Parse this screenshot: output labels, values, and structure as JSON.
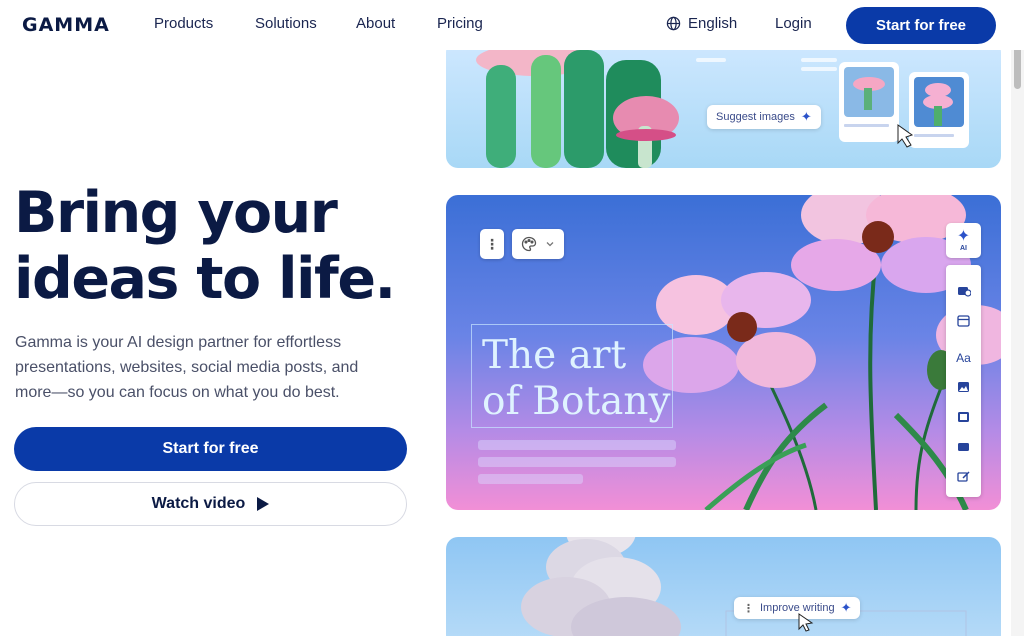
{
  "brand": {
    "logo_text": "GAMMA",
    "accent": "#0a3aa8"
  },
  "nav": {
    "links": [
      "Products",
      "Solutions",
      "About",
      "Pricing"
    ],
    "language": "English",
    "login": "Login",
    "cta": "Start for free"
  },
  "hero": {
    "title_line1": "Bring your",
    "title_line2": "ideas to life.",
    "subtitle": "Gamma is your AI design partner for effortless presentations, websites, social media posts, and more—so you can focus on what you do best.",
    "primary_button": "Start for free",
    "secondary_button": "Watch video"
  },
  "showcase": {
    "suggest_chip": "Suggest images",
    "slide_title_line1": "The art",
    "slide_title_line2": "of Botany",
    "ai_badge": "AI",
    "sidebar_label": "Aa",
    "improve_chip": "Improve writing"
  }
}
